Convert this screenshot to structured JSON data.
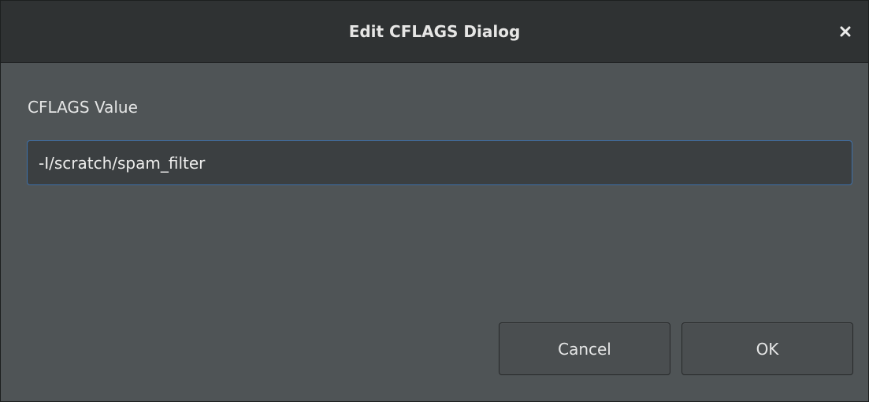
{
  "dialog": {
    "title": "Edit CFLAGS Dialog",
    "close_icon": "close-icon"
  },
  "field": {
    "label": "CFLAGS Value",
    "value": "-I/scratch/spam_filter"
  },
  "buttons": {
    "cancel_label": "Cancel",
    "ok_label": "OK"
  },
  "colors": {
    "titlebar_bg": "#2f3233",
    "dialog_bg": "#4f5456",
    "input_bg": "#3b3f41",
    "focus_border": "#3d6fa8",
    "text": "#e5e6e6"
  }
}
